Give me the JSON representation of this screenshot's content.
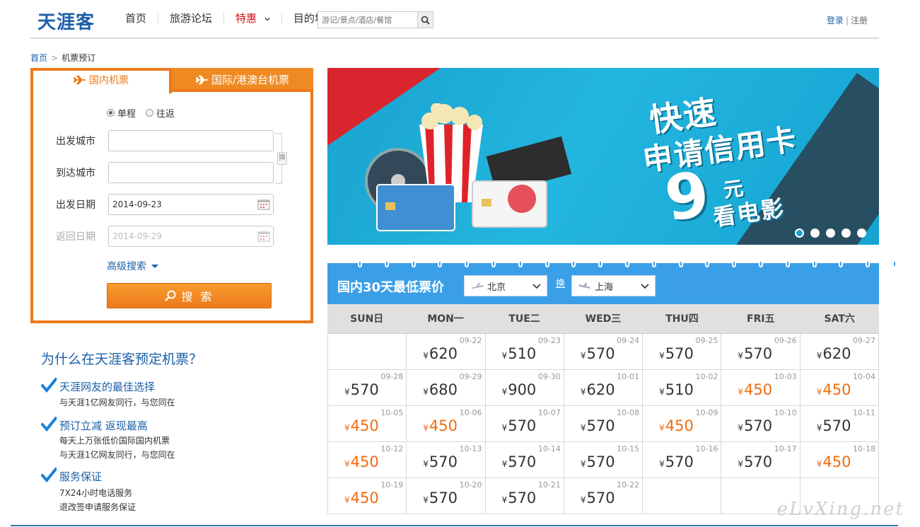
{
  "header": {
    "logo": "天涯客",
    "nav": [
      "首页",
      "旅游论坛",
      "特惠",
      "目的地"
    ],
    "search_placeholder": "游记/景点/酒店/餐馆",
    "login": "登录",
    "separator": "|",
    "register": "注册"
  },
  "breadcrumb": {
    "home": "首页",
    "arrow": ">",
    "current": "机票预订"
  },
  "panel": {
    "tab_domestic": "国内机票",
    "tab_international": "国际/港澳台机票",
    "radio_oneway": "单程",
    "radio_round": "往返",
    "label_from": "出发城市",
    "label_to": "到达城市",
    "label_depart": "出发日期",
    "label_return": "返回日期",
    "depart_date": "2014-09-23",
    "return_date": "2014-09-29",
    "swap": "换",
    "advanced": "高级搜索",
    "search": "搜 索"
  },
  "why": {
    "title": "为什么在天涯客预定机票？",
    "items": [
      {
        "head": "天涯网友的最佳选择",
        "subs": [
          "与天涯1亿网友同行，与您同在"
        ]
      },
      {
        "head": "预订立减 返现最高",
        "subs": [
          "每天上万张低价国际国内机票",
          "与天涯1亿网友同行，与您同在"
        ]
      },
      {
        "head": "服务保证",
        "subs": [
          "7X24小时电话服务",
          "退改签申请服务保证"
        ]
      }
    ]
  },
  "banner": {
    "line1": "快速",
    "line2": "申请信用卡",
    "price": "9",
    "unit": "元",
    "line3": "看电影",
    "slide_count": 5,
    "active_slide": 0
  },
  "calendar": {
    "title": "国内30天最低票价",
    "from_city": "北京",
    "to_city": "上海",
    "swap": "换",
    "currency": "¥",
    "weekdays": [
      "SUN日",
      "MON一",
      "TUE二",
      "WED三",
      "THU四",
      "FRI五",
      "SAT六"
    ],
    "cells": [
      {
        "date": "",
        "price": ""
      },
      {
        "date": "09-22",
        "price": "620"
      },
      {
        "date": "09-23",
        "price": "510"
      },
      {
        "date": "09-24",
        "price": "570"
      },
      {
        "date": "09-25",
        "price": "570"
      },
      {
        "date": "09-26",
        "price": "570"
      },
      {
        "date": "09-27",
        "price": "620"
      },
      {
        "date": "09-28",
        "price": "570"
      },
      {
        "date": "09-29",
        "price": "680"
      },
      {
        "date": "09-30",
        "price": "900"
      },
      {
        "date": "10-01",
        "price": "620"
      },
      {
        "date": "10-02",
        "price": "510"
      },
      {
        "date": "10-03",
        "price": "450",
        "low": true
      },
      {
        "date": "10-04",
        "price": "450",
        "low": true
      },
      {
        "date": "10-05",
        "price": "450",
        "low": true
      },
      {
        "date": "10-06",
        "price": "450",
        "low": true
      },
      {
        "date": "10-07",
        "price": "570"
      },
      {
        "date": "10-08",
        "price": "570"
      },
      {
        "date": "10-09",
        "price": "450",
        "low": true
      },
      {
        "date": "10-10",
        "price": "570"
      },
      {
        "date": "10-11",
        "price": "570"
      },
      {
        "date": "10-12",
        "price": "450",
        "low": true
      },
      {
        "date": "10-13",
        "price": "570"
      },
      {
        "date": "10-14",
        "price": "570"
      },
      {
        "date": "10-15",
        "price": "570"
      },
      {
        "date": "10-16",
        "price": "570"
      },
      {
        "date": "10-17",
        "price": "570"
      },
      {
        "date": "10-18",
        "price": "450",
        "low": true
      },
      {
        "date": "10-19",
        "price": "450",
        "low": true
      },
      {
        "date": "10-20",
        "price": "570"
      },
      {
        "date": "10-21",
        "price": "570"
      },
      {
        "date": "10-22",
        "price": "570"
      },
      {
        "date": "",
        "price": ""
      },
      {
        "date": "",
        "price": ""
      },
      {
        "date": "",
        "price": ""
      }
    ]
  },
  "watermark": "eLvXing.net",
  "colors": {
    "brand_blue": "#1b5fa8",
    "accent_orange": "#ec7a1c",
    "calendar_blue": "#3a9fe7",
    "low_price": "#f26b0f",
    "hot_red": "#d6111a"
  }
}
